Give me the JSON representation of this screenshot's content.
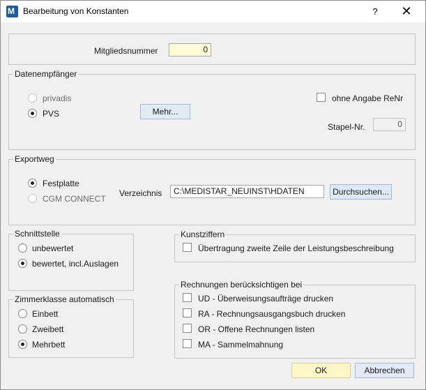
{
  "window": {
    "title": "Bearbeitung von Konstanten",
    "help_glyph": "?",
    "close_glyph": "✕",
    "icon_letter": "M"
  },
  "member": {
    "label": "Mitgliedsnummer",
    "value": "0"
  },
  "datenempfaenger": {
    "legend": "Datenempfänger",
    "options": [
      {
        "label": "privadis",
        "selected": false,
        "enabled": false
      },
      {
        "label": "PVS",
        "selected": true,
        "enabled": true
      }
    ],
    "more_button": "Mehr...",
    "ohne_renr_label": "ohne Angabe ReNr",
    "stapel_label": "Stapel-Nr.",
    "stapel_value": "0"
  },
  "exportweg": {
    "legend": "Exportweg",
    "options": [
      {
        "label": "Festplatte",
        "selected": true,
        "enabled": true
      },
      {
        "label": "CGM CONNECT",
        "selected": false,
        "enabled": false
      }
    ],
    "dir_label": "Verzeichnis",
    "dir_value": "C:\\MEDISTAR_NEUINST\\HDATEN",
    "browse_button": "Durchsuchen..."
  },
  "schnittstelle": {
    "legend": "Schnittstelle",
    "options": [
      {
        "label": "unbewertet",
        "selected": false
      },
      {
        "label": "bewertet, incl.Auslagen",
        "selected": true
      }
    ]
  },
  "kunstziffern": {
    "legend": "Kunstziffern",
    "checkbox_label": "Übertragung zweite Zeile der Leistungsbeschreibung"
  },
  "zimmerklasse": {
    "legend": "Zimmerklasse automatisch",
    "options": [
      {
        "label": "Einbett",
        "selected": false
      },
      {
        "label": "Zweibett",
        "selected": false
      },
      {
        "label": "Mehrbett",
        "selected": true
      }
    ]
  },
  "rechnungen": {
    "legend": "Rechnungen berücksichtigen bei",
    "items": [
      {
        "label": "UD - Überweisungsaufträge drucken"
      },
      {
        "label": "RA - Rechnungsausgangsbuch drucken"
      },
      {
        "label": "OR - Offene Rechnungen listen"
      },
      {
        "label": "MA - Sammelmahnung"
      }
    ]
  },
  "footer": {
    "ok": "OK",
    "cancel": "Abbrechen"
  },
  "colors": {
    "accent_button": "#e2eaf6",
    "default_button": "#fff6c8",
    "input_highlight": "#fffbd5",
    "app_icon": "#1e5aa8"
  }
}
